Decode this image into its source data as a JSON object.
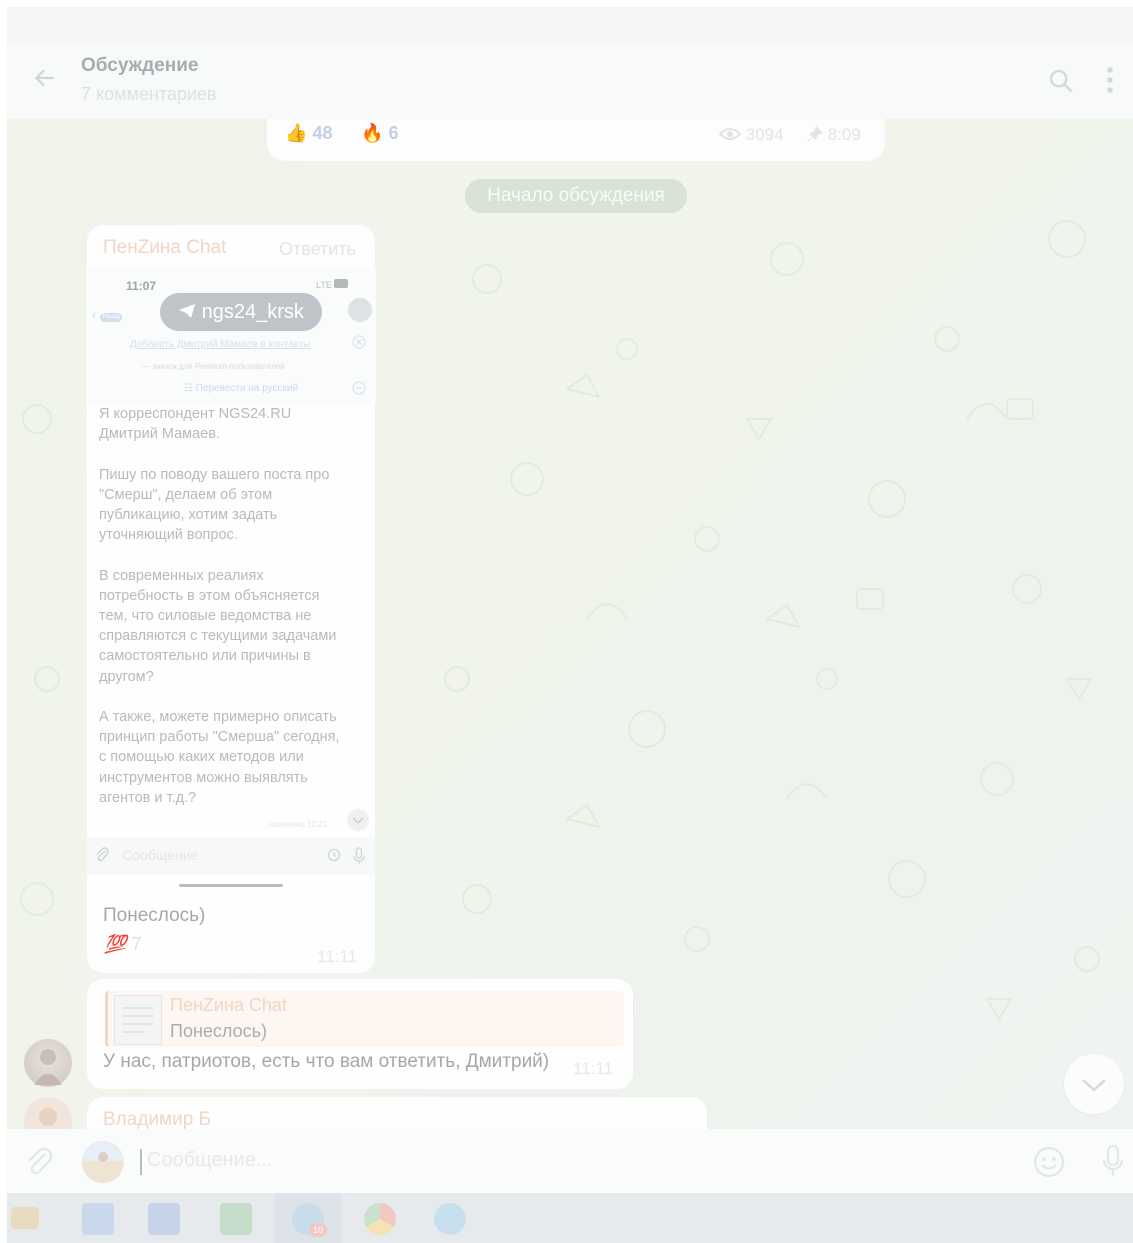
{
  "header": {
    "title": "Обсуждение",
    "subtitle": "7 комментариев"
  },
  "post_footer": {
    "reactions": [
      {
        "emoji": "👍",
        "count": "48"
      },
      {
        "emoji": "🔥",
        "count": "6"
      }
    ],
    "views": "3094",
    "time": "8:09"
  },
  "service_message": "Начало обсуждения",
  "messages": [
    {
      "sender": "ПенZина Chat",
      "reply_label": "Ответить",
      "screenshot": {
        "status_time": "11:07",
        "network": "LTE",
        "back_label": "Назад",
        "chat_name": "ngs24_krsk",
        "add_contact": "Добавить Дмитрий Мамаев в контакты",
        "premium_note": "— значок для Premium-пользователей",
        "translate": "Перевести на русский",
        "text": "Я корреспондент NGS24.RU\nДмитрий Мамаев.\n\nПишу по поводу вашего поста про \"Смерш\", делаем об этом публикацию, хотим задать уточняющий вопрос.\n\nВ современных реалиях потребность в этом объясняется тем, что силовые ведомства не справляются с текущими задачами самостоятельно или причины в другом?\n\nА также, можете примерно описать принцип работы \"Смерша\" сегодня, с помощью каких методов или инструментов можно выявлять агентов и т.д.?",
        "edited_time": "изменено 10:21",
        "input_placeholder": "Сообщение"
      },
      "text": "Понеслось)",
      "reaction": {
        "emoji": "💯",
        "count": "7"
      },
      "time": "11:11"
    },
    {
      "quote_sender": "ПенZина Chat",
      "quote_text": "Понеслось)",
      "text": "У нас, патриотов, есть что вам ответить, Дмитрий)",
      "time": "11:11"
    },
    {
      "sender": "Владимир Б"
    }
  ],
  "composer": {
    "placeholder": "Сообщение..."
  },
  "taskbar": {
    "apps": [
      "file-explorer",
      "outlook",
      "word",
      "excel",
      "telegram",
      "chrome",
      "skype"
    ],
    "telegram_badge": "10"
  },
  "colors": {
    "sender_name": "#f1d5c6",
    "chat_wallpaper": "#eef3ec",
    "service_pill": "#d8e2d6",
    "reaction_count": "#c2cfe2"
  }
}
